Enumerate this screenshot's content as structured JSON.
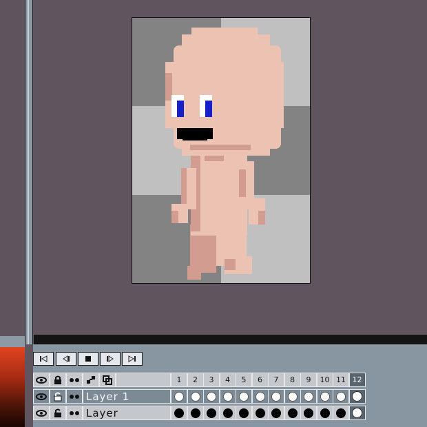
{
  "layers": [
    {
      "name": "Layer 1",
      "selected": true
    },
    {
      "name": "Layer",
      "selected": false
    }
  ],
  "frames": [
    "1",
    "2",
    "3",
    "4",
    "5",
    "6",
    "7",
    "8",
    "9",
    "10",
    "11",
    "12"
  ],
  "current_frame": "12",
  "colors": {
    "background": "#60545e",
    "panel": "#8896a2",
    "selected_row": "#7c8a96",
    "skin": "#ecc2b2",
    "skin_shadow": "#d29d90",
    "eye_blue": "#1520c8"
  },
  "transport": [
    "first-frame",
    "previous-frame",
    "stop",
    "play",
    "last-frame"
  ]
}
